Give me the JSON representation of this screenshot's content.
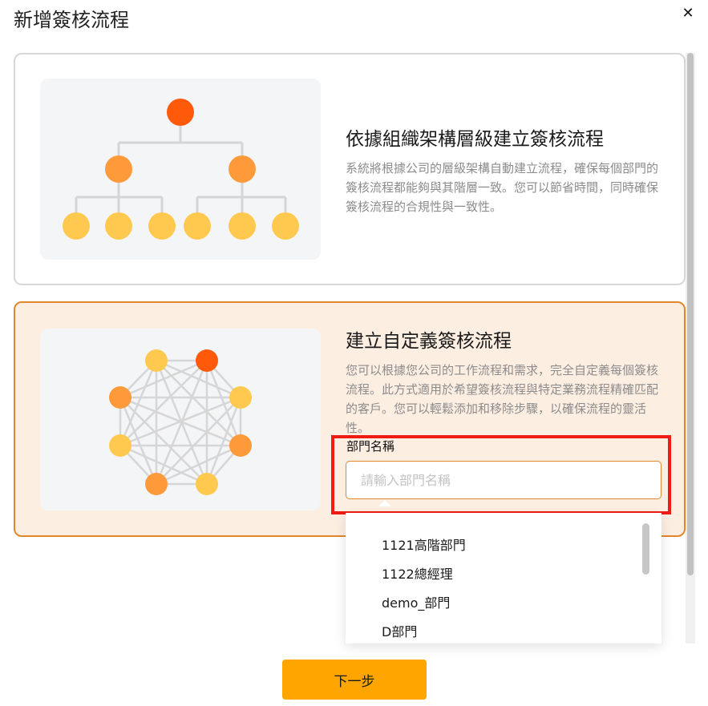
{
  "dialog": {
    "title": "新增簽核流程",
    "close_icon": "close-icon"
  },
  "options": [
    {
      "title": "依據組織架構層級建立簽核流程",
      "description": "系統將根據公司的層級架構自動建立流程，確保每個部門的簽核流程都能夠與其階層一致。您可以節省時間，同時確保簽核流程的合規性與一致性。",
      "illustration": "org-hierarchy-illustration",
      "selected": false
    },
    {
      "title": "建立自定義簽核流程",
      "description": "您可以根據您公司的工作流程和需求，完全自定義每個簽核流程。此方式適用於希望簽核流程與特定業務流程精確匹配的客戶。您可以輕鬆添加和移除步驟，以確保流程的靈活性。",
      "illustration": "network-illustration",
      "selected": true
    }
  ],
  "department": {
    "label": "部門名稱",
    "placeholder": "請輸入部門名稱",
    "value": "",
    "dropdown_items": [
      "1121高階部門",
      "1122總經理",
      "demo_部門",
      "D部門"
    ]
  },
  "footer": {
    "next_label": "下一步"
  },
  "colors": {
    "accent": "#ffa500",
    "selected_border": "#e0872c",
    "selected_bg": "#fdeee2",
    "highlight_box": "#ee1c12",
    "node_top": "#ff5a0a",
    "node_mid": "#ff9a3a",
    "node_leaf": "#ffc94f"
  }
}
